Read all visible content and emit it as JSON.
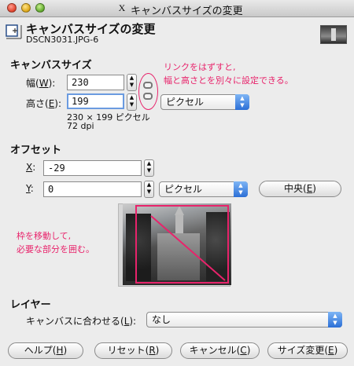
{
  "window": {
    "title": "キャンバスサイズの変更",
    "x_icon": "X"
  },
  "header": {
    "title": "キャンバスサイズの変更",
    "subtitle": "DSCN3031.JPG-6",
    "icon": "canvas-resize-icon"
  },
  "canvas_size": {
    "section": "キャンバスサイズ",
    "width_label_pre": "幅(",
    "width_label_key": "W",
    "width_label_post": "):",
    "width_value": "230",
    "height_label_pre": "高さ(",
    "height_label_key": "E",
    "height_label_post": "):",
    "height_value": "199",
    "unit": "ピクセル",
    "info_size": "230 × 199 ピクセル",
    "info_dpi": "72 dpi"
  },
  "offset": {
    "section": "オフセット",
    "x_label_key": "X",
    "x_label_post": ":",
    "x_value": "-29",
    "y_label_key": "Y",
    "y_label_post": ":",
    "y_value": "0",
    "unit": "ピクセル",
    "center_pre": "中央(",
    "center_key": "E",
    "center_post": ")"
  },
  "annotations": {
    "chain_note_1": "リンクをはずすと,",
    "chain_note_2": "幅と高さとを別々に設定できる。",
    "frame_note_1": "枠を移動して,",
    "frame_note_2": "必要な部分を囲む。"
  },
  "layers": {
    "section": "レイヤー",
    "fit_label_pre": "キャンバスに合わせる(",
    "fit_label_key": "L",
    "fit_label_post": "):",
    "fit_value": "なし"
  },
  "buttons": {
    "help_pre": "ヘルプ(",
    "help_key": "H",
    "help_post": ")",
    "reset_pre": "リセット(",
    "reset_key": "R",
    "reset_post": ")",
    "cancel_pre": "キャンセル(",
    "cancel_key": "C",
    "cancel_post": ")",
    "resize_pre": "サイズ変更(",
    "resize_key": "E",
    "resize_post": ")"
  },
  "colors": {
    "annotation": "#e8236b",
    "accent": "#2c6fd6"
  }
}
